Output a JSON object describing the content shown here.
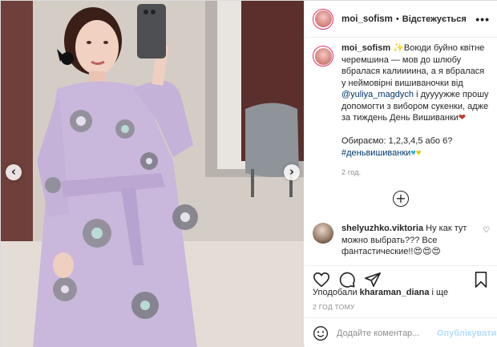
{
  "header": {
    "username": "moi_sofism",
    "separator": "•",
    "follow_label": "Відстежується",
    "more_label": "•••"
  },
  "caption": {
    "username": "moi_sofism",
    "spark": "✨",
    "line1": "Воюди буйно квітне черемшина — мов до шлюбу вбралася калиииина, а я вбралася у неймовірні вишиваночки від ",
    "mention": "@yuliya_magdych",
    "line2": " і дуууужже прошу допомогти з вибором сукенки, адже за тиждень День Вишиванки",
    "heart": "❤",
    "vote": "Обираємо: 1,2,3,4,5 або 6?",
    "hashtag": "#деньвишиванки",
    "blue_heart": "♥",
    "yellow_heart": "♥",
    "time": "2 год."
  },
  "load_more_label": "+",
  "comment": {
    "username": "shelyuzhko.viktoria",
    "text": " Ну как тут можно выбрать??? Все фантастические!!",
    "emojis": "😍😍😍",
    "like_icon": "♡"
  },
  "likes": {
    "prefix": "Уподобали ",
    "user": "kharaman_diana",
    "suffix": " і ще"
  },
  "timestamp": "2 ГОД ТОМУ",
  "add_comment": {
    "placeholder": "Додайте коментар...",
    "publish_label": "Опублікувати"
  },
  "nav": {
    "prev": "‹",
    "next": "›"
  },
  "icons": [
    "heart-icon",
    "comment-icon",
    "share-icon",
    "bookmark-icon",
    "emoji-icon"
  ],
  "colors": {
    "accent": "#0095f6",
    "publish_disabled": "#b2dffc",
    "story_ring": "#e1306c",
    "dress": "#c9b8dc"
  }
}
